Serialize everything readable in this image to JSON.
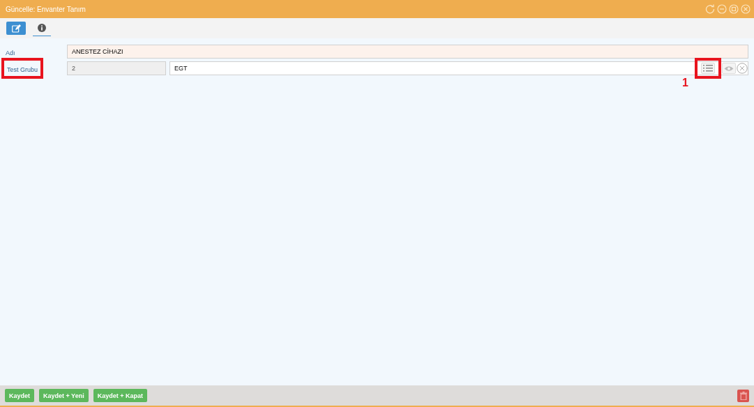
{
  "window": {
    "title": "Güncelle: Envanter Tanım"
  },
  "tabs": [
    {
      "kind": "edit",
      "selected": true
    },
    {
      "kind": "info",
      "selected": false
    }
  ],
  "fields": [
    {
      "label": "Adı",
      "label_highlighted": false,
      "value": "ANESTEZ CİHAZI",
      "kind": "text"
    },
    {
      "label": "Test Grubu",
      "label_highlighted": true,
      "code": "2",
      "value": "EGT",
      "kind": "lookup",
      "list_highlighted": true,
      "callout": "1"
    }
  ],
  "buttons": [
    "Kaydet",
    "Kaydet + Yeni",
    "Kaydet + Kapat"
  ]
}
